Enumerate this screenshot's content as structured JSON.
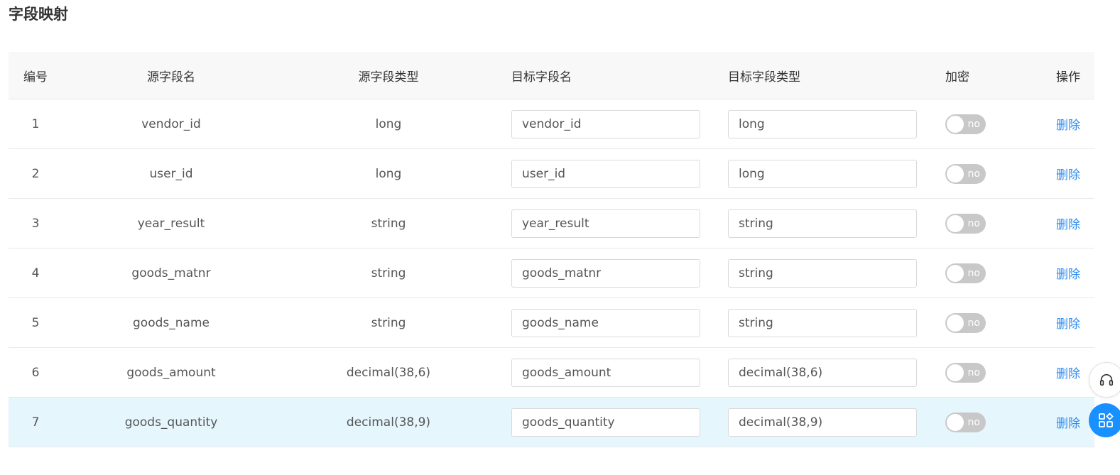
{
  "page": {
    "title": "字段映射"
  },
  "table": {
    "headers": {
      "no": "编号",
      "source_name": "源字段名",
      "source_type": "源字段类型",
      "target_name": "目标字段名",
      "target_type": "目标字段类型",
      "encrypt": "加密",
      "action": "操作"
    },
    "rows": [
      {
        "no": "1",
        "source_name": "vendor_id",
        "source_type": "long",
        "target_name": "vendor_id",
        "target_type": "long",
        "encrypt": "no",
        "encrypt_on": false,
        "action": "删除"
      },
      {
        "no": "2",
        "source_name": "user_id",
        "source_type": "long",
        "target_name": "user_id",
        "target_type": "long",
        "encrypt": "no",
        "encrypt_on": false,
        "action": "删除"
      },
      {
        "no": "3",
        "source_name": "year_result",
        "source_type": "string",
        "target_name": "year_result",
        "target_type": "string",
        "encrypt": "no",
        "encrypt_on": false,
        "action": "删除"
      },
      {
        "no": "4",
        "source_name": "goods_matnr",
        "source_type": "string",
        "target_name": "goods_matnr",
        "target_type": "string",
        "encrypt": "no",
        "encrypt_on": false,
        "action": "删除"
      },
      {
        "no": "5",
        "source_name": "goods_name",
        "source_type": "string",
        "target_name": "goods_name",
        "target_type": "string",
        "encrypt": "no",
        "encrypt_on": false,
        "action": "删除"
      },
      {
        "no": "6",
        "source_name": "goods_amount",
        "source_type": "decimal(38,6)",
        "target_name": "goods_amount",
        "target_type": "decimal(38,6)",
        "encrypt": "no",
        "encrypt_on": false,
        "action": "删除"
      },
      {
        "no": "7",
        "source_name": "goods_quantity",
        "source_type": "decimal(38,9)",
        "target_name": "goods_quantity",
        "target_type": "decimal(38,9)",
        "encrypt": "no",
        "encrypt_on": false,
        "action": "删除"
      }
    ]
  },
  "floating_buttons": [
    {
      "icon": "headset-icon"
    },
    {
      "icon": "app-grid-icon"
    }
  ],
  "colors": {
    "accent": "#2d8cf0",
    "float_button": "#1890ff",
    "header_bg": "#f8f8f8",
    "highlight_row_bg": "#e6f6fd",
    "switch_off": "#c8c8c8"
  }
}
